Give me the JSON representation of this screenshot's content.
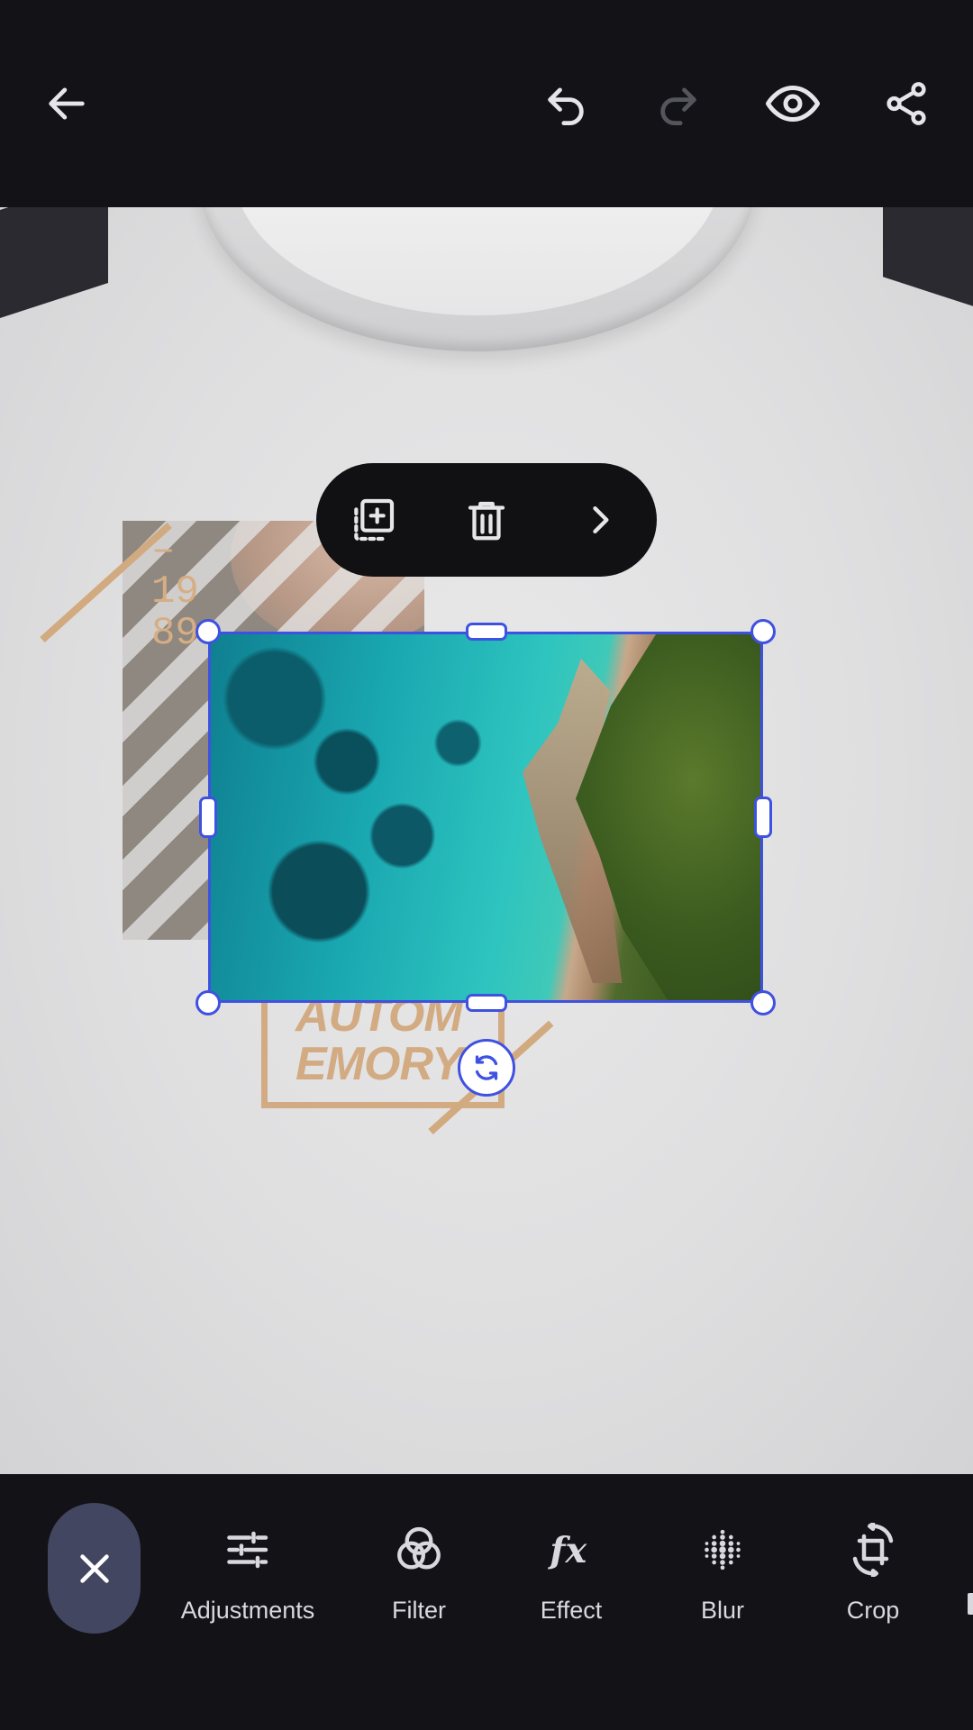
{
  "top_bar": {
    "back_icon": "arrow-left-icon",
    "undo_icon": "undo-icon",
    "redo_icon": "redo-icon",
    "preview_icon": "eye-icon",
    "share_icon": "share-icon"
  },
  "canvas": {
    "design_year": [
      "–",
      "19",
      "89"
    ],
    "design_text": [
      "AUTOM",
      "EMORY"
    ]
  },
  "context_menu": {
    "items": [
      {
        "icon": "duplicate-icon"
      },
      {
        "icon": "trash-icon"
      },
      {
        "icon": "chevron-right-icon"
      }
    ]
  },
  "selection": {
    "rotate_icon": "rotate-icon"
  },
  "bottom_toolbar": {
    "close_icon": "close-icon",
    "tools": [
      {
        "label": "Adjustments",
        "icon": "sliders-icon"
      },
      {
        "label": "Filter",
        "icon": "filter-circles-icon"
      },
      {
        "label": "Effect",
        "icon": "fx-icon"
      },
      {
        "label": "Blur",
        "icon": "blur-dots-icon"
      },
      {
        "label": "Crop",
        "icon": "crop-rotate-icon"
      }
    ]
  },
  "colors": {
    "accent": "#3f51e0",
    "background": "#121217",
    "close_button": "#434660",
    "design_tan": "#d3ab82"
  }
}
